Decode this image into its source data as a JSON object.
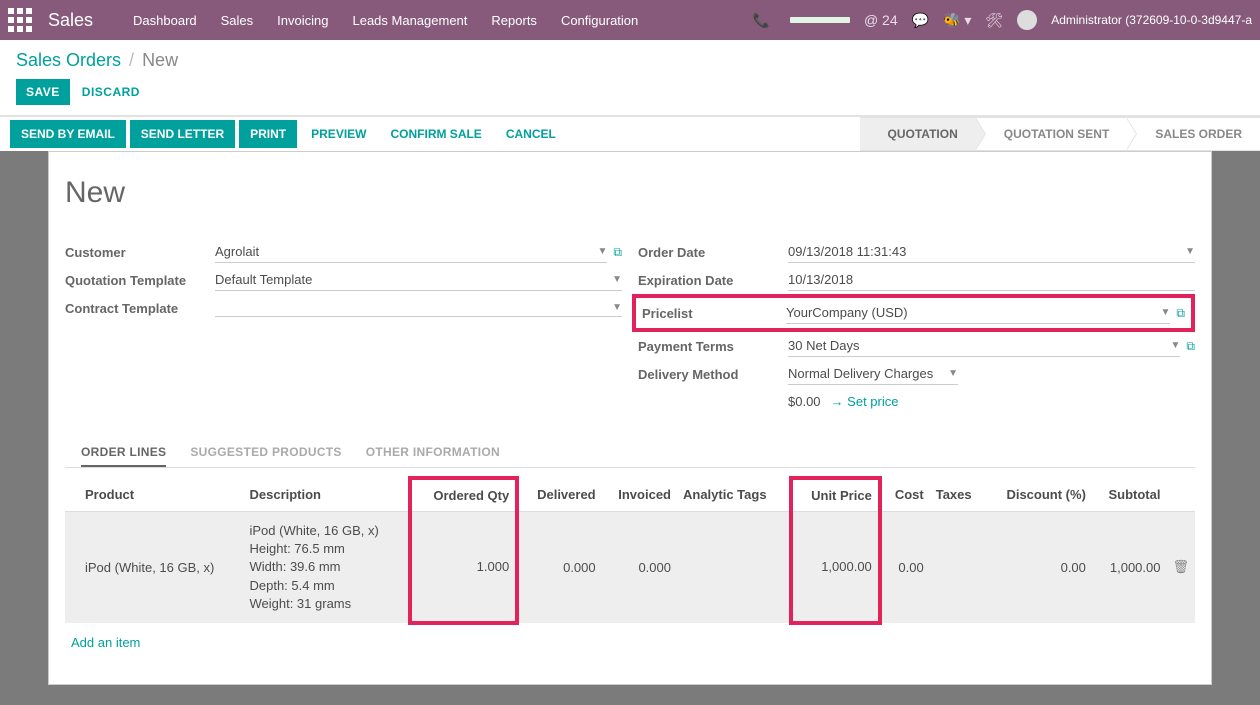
{
  "topbar": {
    "app_title": "Sales",
    "menu": [
      "Dashboard",
      "Sales",
      "Invoicing",
      "Leads Management",
      "Reports",
      "Configuration"
    ],
    "mail_count": "@ 24",
    "user": "Administrator (372609-10-0-3d9447-a"
  },
  "breadcrumb": {
    "root": "Sales Orders",
    "current": "New"
  },
  "buttons": {
    "save": "SAVE",
    "discard": "DISCARD",
    "send_email": "SEND BY EMAIL",
    "send_letter": "SEND LETTER",
    "print": "PRINT",
    "preview": "PREVIEW",
    "confirm": "CONFIRM SALE",
    "cancel": "CANCEL"
  },
  "status": {
    "quotation": "QUOTATION",
    "quotation_sent": "QUOTATION SENT",
    "sales_order": "SALES ORDER"
  },
  "form_title": "New",
  "labels": {
    "customer": "Customer",
    "quotation_template": "Quotation Template",
    "contract_template": "Contract Template",
    "order_date": "Order Date",
    "expiration_date": "Expiration Date",
    "pricelist": "Pricelist",
    "payment_terms": "Payment Terms",
    "delivery_method": "Delivery Method"
  },
  "values": {
    "customer": "Agrolait",
    "quotation_template": "Default Template",
    "contract_template": "",
    "order_date": "09/13/2018 11:31:43",
    "expiration_date": "10/13/2018",
    "pricelist": "YourCompany (USD)",
    "payment_terms": "30 Net Days",
    "delivery_method": "Normal Delivery Charges",
    "delivery_price": "$0.00",
    "set_price": "Set price"
  },
  "tabs_labels": {
    "order_lines": "ORDER LINES",
    "suggested": "SUGGESTED PRODUCTS",
    "other": "OTHER INFORMATION"
  },
  "columns": {
    "product": "Product",
    "description": "Description",
    "ordered_qty": "Ordered Qty",
    "delivered": "Delivered",
    "invoiced": "Invoiced",
    "analytic_tags": "Analytic Tags",
    "unit_price": "Unit Price",
    "cost": "Cost",
    "taxes": "Taxes",
    "discount": "Discount (%)",
    "subtotal": "Subtotal"
  },
  "line": {
    "product": "iPod (White, 16 GB, x)",
    "description": "iPod (White, 16 GB, x)\nHeight: 76.5 mm\nWidth:  39.6 mm\nDepth:  5.4 mm\nWeight: 31 grams",
    "ordered_qty": "1.000",
    "delivered": "0.000",
    "invoiced": "0.000",
    "analytic_tags": "",
    "unit_price": "1,000.00",
    "cost": "0.00",
    "taxes": "",
    "discount": "0.00",
    "subtotal": "1,000.00"
  },
  "add_item": "Add an item"
}
